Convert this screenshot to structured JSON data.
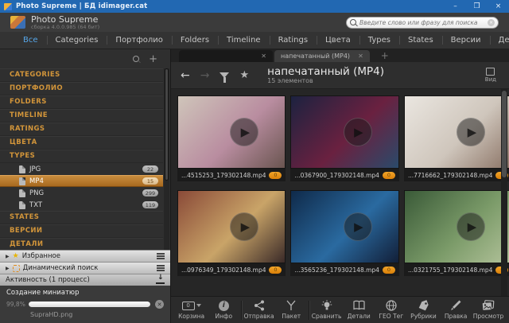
{
  "window": {
    "title": "Photo Supreme | БД idimager.cat",
    "minimize": "–",
    "maximize": "❒",
    "close": "×"
  },
  "header": {
    "app_name": "Photo Supreme",
    "app_version": "сборка 4.0.0.985 (64 бит)",
    "search_placeholder": "Введите слово или фразу для поиска"
  },
  "nav": {
    "active": "Все",
    "tabs": [
      "Все",
      "Categories",
      "Портфолио",
      "Folders",
      "Timeline",
      "Ratings",
      "Цвета",
      "Types",
      "States",
      "Версии",
      "Детали"
    ]
  },
  "sidebar": {
    "sections_top": [
      "CATEGORIES",
      "ПОРТФОЛИО",
      "FOLDERS",
      "TIMELINE",
      "RATINGS",
      "ЦВЕТА",
      "TYPES"
    ],
    "types": [
      {
        "label": "JPG",
        "count": "22",
        "selected": false
      },
      {
        "label": "MP4",
        "count": "15",
        "selected": true
      },
      {
        "label": "PNG",
        "count": "299",
        "selected": false
      },
      {
        "label": "TXT",
        "count": "119",
        "selected": false
      }
    ],
    "sections_bottom": [
      "STATES",
      "ВЕРСИИ",
      "ДЕТАЛИ"
    ],
    "panels": {
      "favorites": "Избранное",
      "dynamic_search": "Динамический поиск",
      "activity": "Активность (1 процесс)"
    },
    "activity": {
      "task": "Создание миниатюр",
      "percent": "99,8%",
      "progress_value": 99.8,
      "file": "SupraHD.png"
    }
  },
  "workspace": {
    "tabs": [
      {
        "label": ""
      },
      {
        "label": "напечатанный (MP4)"
      }
    ],
    "new_tab": "+",
    "title": "напечатанный (MP4)",
    "count": "15 элементов",
    "view_label": "Вид",
    "items": [
      {
        "name": "...4515253_179302148.mp4",
        "badge": "0",
        "colors": [
          "#cfc5ba",
          "#b98da0",
          "#6a5550"
        ]
      },
      {
        "name": "...0367900_179302148.mp4",
        "badge": "0",
        "colors": [
          "#1c2240",
          "#6a2140",
          "#2a4a6a"
        ]
      },
      {
        "name": "...7716662_179302148.mp4",
        "badge": "0",
        "colors": [
          "#eae6e0",
          "#cfc6bc",
          "#8a7264"
        ]
      },
      {
        "name": "...0976349_179302148.mp4",
        "badge": "0",
        "colors": [
          "#8a4a38",
          "#c9a468",
          "#3a2a28"
        ]
      },
      {
        "name": "...3565236_179302148.mp4",
        "badge": "0",
        "colors": [
          "#0f2a4a",
          "#2a6aa0",
          "#121f38"
        ]
      },
      {
        "name": "...0321755_179302148.mp4",
        "badge": "0",
        "colors": [
          "#3a5a38",
          "#7a9a68",
          "#b2c29a"
        ]
      }
    ],
    "toolbar": [
      {
        "label": "Корзина",
        "count": "0",
        "icon": "basket-icon"
      },
      {
        "label": "Инфо",
        "icon": "info-icon"
      },
      {
        "label": "Отправка",
        "icon": "share-icon"
      },
      {
        "label": "Пакет",
        "icon": "merge-icon"
      },
      {
        "label": "Сравнить",
        "icon": "lightbulb-icon"
      },
      {
        "label": "Детали",
        "icon": "book-icon"
      },
      {
        "label": "ГЕО Тег",
        "icon": "globe-icon"
      },
      {
        "label": "Рубрики",
        "icon": "tag-icon"
      },
      {
        "label": "Правка",
        "icon": "brush-icon"
      },
      {
        "label": "Просмотр",
        "icon": "viewer-icon"
      }
    ]
  },
  "colors": {
    "titlebar_blue": "#2268b2",
    "accent_orange": "#d2953a",
    "selected_row_orange": "#b5772e",
    "active_tab_blue": "#56a6e8",
    "badge_orange": "#e8920f"
  }
}
